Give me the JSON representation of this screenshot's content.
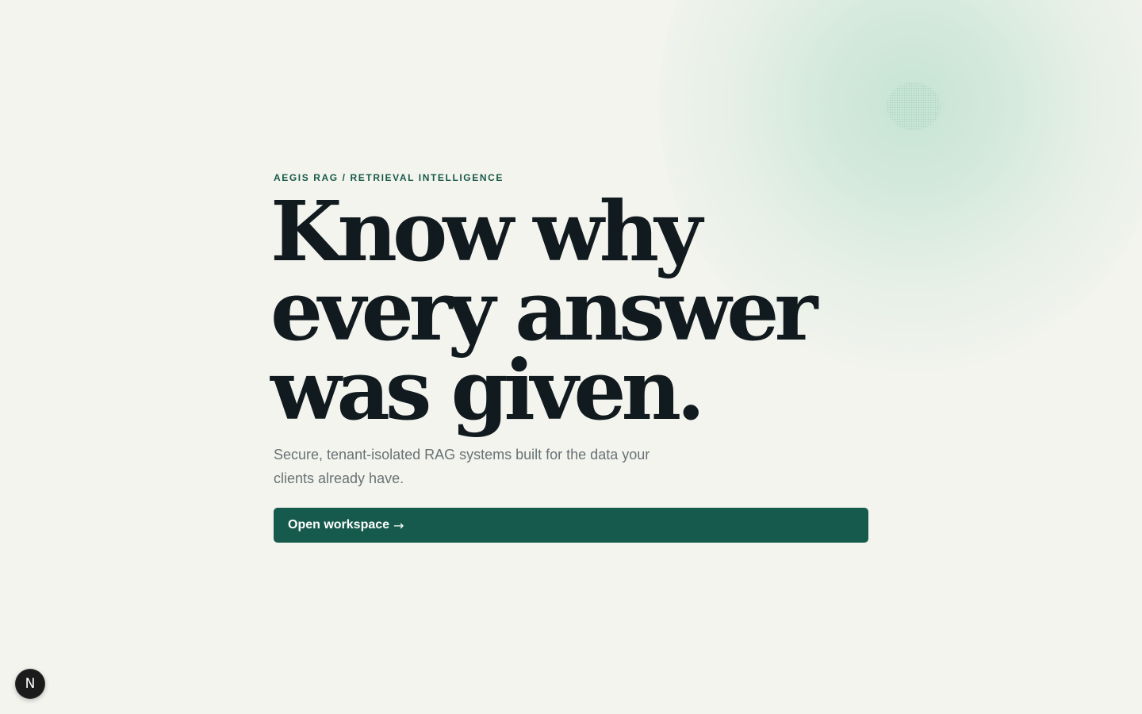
{
  "hero": {
    "eyebrow": "AEGIS RAG / RETRIEVAL INTELLIGENCE",
    "headline_lines": [
      "Know why",
      "every answer",
      "was given."
    ],
    "subcopy": "Secure, tenant-isolated RAG systems built for the data your clients already have.",
    "cta_label": "Open workspace",
    "cta_arrow": "→"
  },
  "dev_badge": {
    "label": "N",
    "icon": "nextjs-logo-icon"
  },
  "colors": {
    "background": "#f4f4ef",
    "accent": "#155a4c",
    "eyebrow": "#175a4a",
    "headline": "#111a1e",
    "subcopy": "#687274",
    "glow": "#a0d7be"
  }
}
